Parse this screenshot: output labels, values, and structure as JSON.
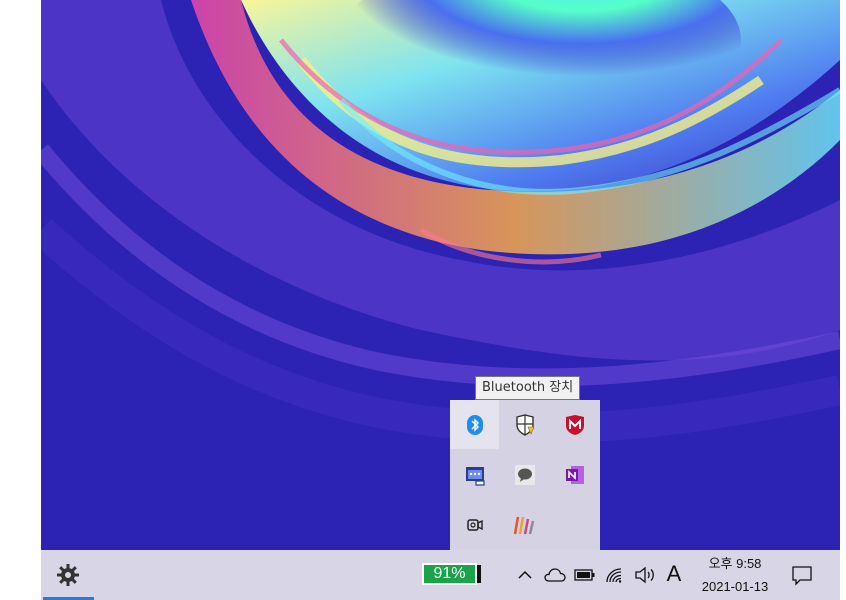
{
  "tooltip": {
    "text": "Bluetooth 장치"
  },
  "tray_overflow": {
    "icons": [
      {
        "name": "bluetooth-icon",
        "color": "#1e90ff"
      },
      {
        "name": "windows-security-warning-icon",
        "color": "#f2c12e"
      },
      {
        "name": "mcafee-icon",
        "color": "#c8102e"
      },
      {
        "name": "chat-window-icon",
        "color": "#2a3c8f"
      },
      {
        "name": "speech-bubble-icon",
        "color": "#555555"
      },
      {
        "name": "onenote-icon",
        "color": "#7719aa"
      },
      {
        "name": "video-camera-icon",
        "color": "#222222"
      },
      {
        "name": "striped-app-icon",
        "color": "#e0582a"
      }
    ]
  },
  "taskbar": {
    "settings_icon": "gear-icon",
    "battery_percent_label": "91%",
    "battery_level": 0.91,
    "clock": {
      "time": "오후 9:58",
      "date": "2021-01-13"
    },
    "ime_label": "A",
    "accent_color": "#2b7ad6",
    "battery_color": "#1aa34a"
  }
}
